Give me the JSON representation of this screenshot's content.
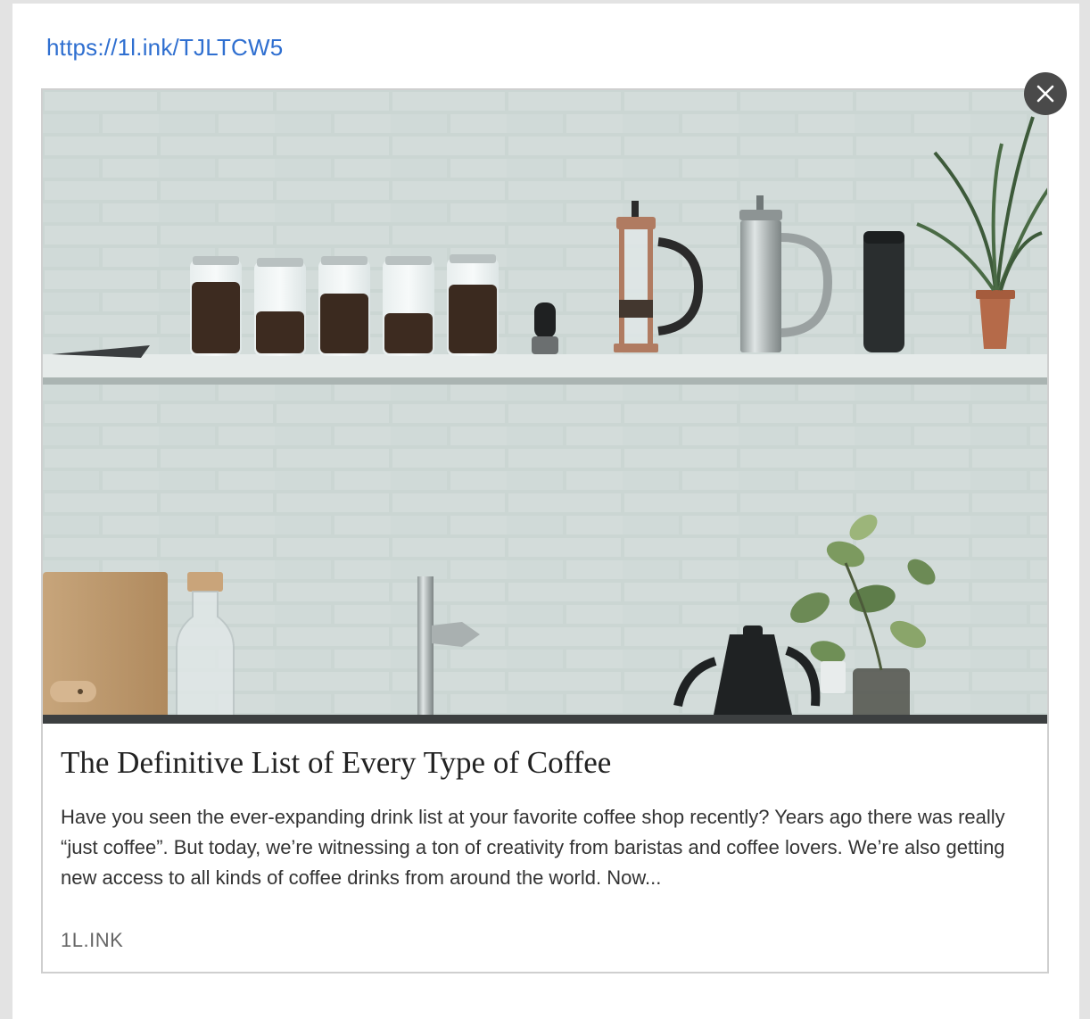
{
  "link": {
    "url": "https://1l.ink/TJLTCW5"
  },
  "preview": {
    "title": "The Definitive List of Every Type of Coffee",
    "description": "Have you seen the ever-expanding drink list at your favorite coffee shop recently? Years ago there was really “just coffee”. But today, we’re witnessing a ton of creativity from baristas and coffee lovers. We’re also getting new access to all kinds of coffee drinks from around the world. Now...",
    "domain": "1L.INK",
    "image_icon": "kitchen-shelf-coffee-photo"
  },
  "controls": {
    "close_icon": "close-icon"
  },
  "colors": {
    "link": "#2f6fd0",
    "close_button": "#4a4a4a",
    "border": "#cfcfcf"
  }
}
